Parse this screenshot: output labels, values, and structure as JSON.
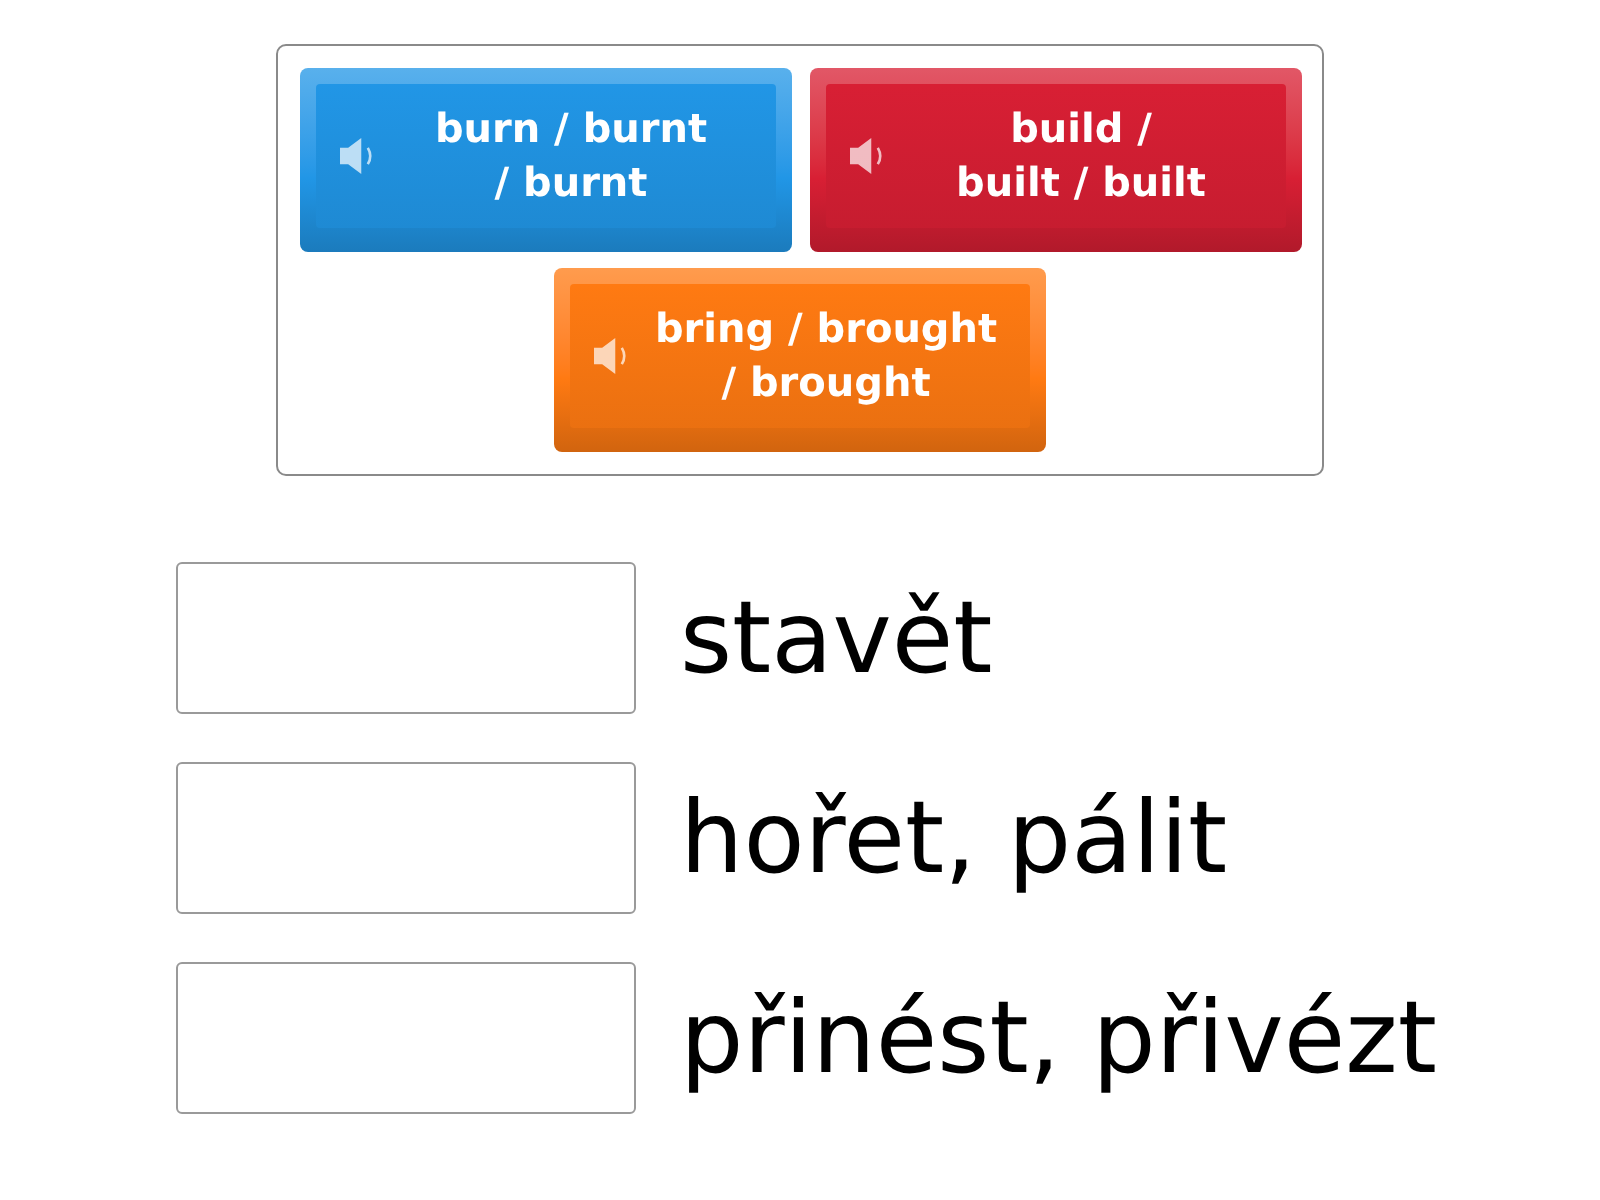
{
  "tiles": [
    {
      "lines": [
        "burn / burnt",
        "/ burnt"
      ],
      "color": "#2196e6"
    },
    {
      "lines": [
        "build /",
        "built / built"
      ],
      "color": "#d81f34"
    },
    {
      "lines": [
        "bring / brought",
        "/ brought"
      ],
      "color": "#ff7a12"
    }
  ],
  "rows": [
    {
      "label": "stavět"
    },
    {
      "label": "hořet, pálit"
    },
    {
      "label": "přinést, přivézt"
    }
  ]
}
